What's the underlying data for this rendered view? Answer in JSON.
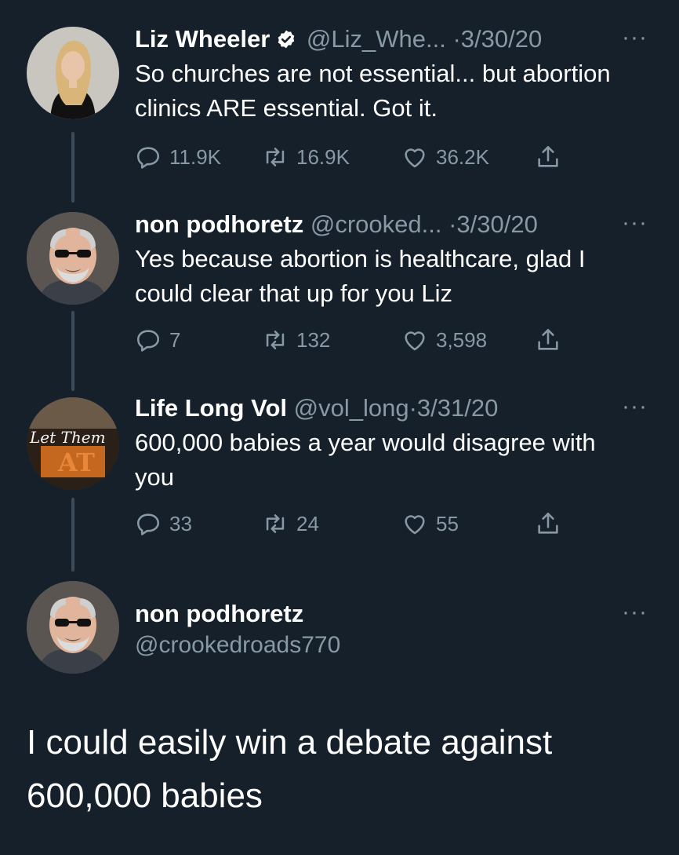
{
  "tweets": [
    {
      "name": "Liz Wheeler",
      "verified": true,
      "handle": "@Liz_Whe...",
      "dot": "·",
      "date": "3/30/20",
      "more": "···",
      "text": "So churches are not essential... but abortion clinics ARE essential. Got it.",
      "replies": "11.9K",
      "retweets": "16.9K",
      "likes": "36.2K"
    },
    {
      "name": "non podhoretz",
      "verified": false,
      "handle": "@crooked...",
      "dot": "·",
      "date": "3/30/20",
      "more": "···",
      "text": "Yes because abortion is healthcare, glad I could clear that up for you Liz",
      "replies": "7",
      "retweets": "132",
      "likes": "3,598"
    },
    {
      "name": "Life Long Vol",
      "verified": false,
      "handle": "@vol_long",
      "dot": "·",
      "date": "3/31/20",
      "more": "···",
      "text": "600,000 babies a year would disagree with you",
      "replies": "33",
      "retweets": "24",
      "likes": "55",
      "avatar_text": "Let Them"
    }
  ],
  "main": {
    "name": "non podhoretz",
    "handle": "@crookedroads770",
    "more": "···",
    "text": "I could easily win a debate against 600,000 babies"
  },
  "colors": {
    "background": "#15202b",
    "secondary_text": "#8899a6",
    "verified": "#ffffff",
    "thread_line": "#3d4a57"
  },
  "icons": [
    "verified-badge-icon",
    "reply-icon",
    "retweet-icon",
    "like-icon",
    "share-icon",
    "more-icon"
  ]
}
